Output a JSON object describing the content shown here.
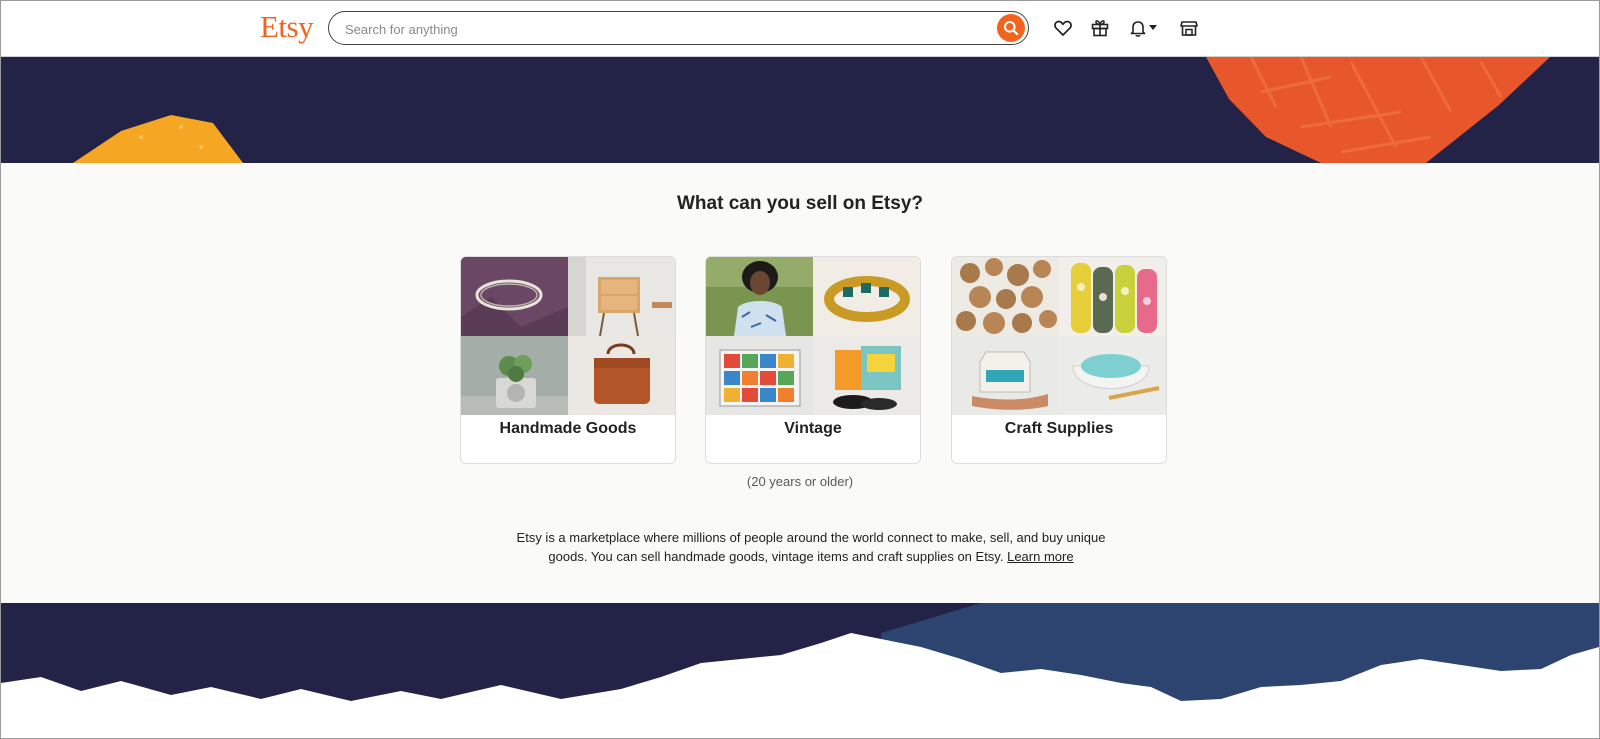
{
  "header": {
    "logo": "Etsy",
    "search": {
      "placeholder": "Search for anything",
      "value": ""
    },
    "icons": [
      "heart-icon",
      "gift-icon",
      "bell-icon",
      "chevron-down-icon",
      "shop-icon"
    ]
  },
  "main": {
    "heading": "What can you sell on Etsy?",
    "cards": [
      {
        "label": "Handmade Goods"
      },
      {
        "label": "Vintage"
      },
      {
        "label": "Craft Supplies"
      }
    ],
    "vintage_note": "(20 years or older)",
    "description": "Etsy is a marketplace where millions of people around the world connect to make, sell, and buy unique goods. You can sell handmade goods, vintage items and craft supplies on Etsy.",
    "learn_more": "Learn more"
  },
  "colors": {
    "brand": "#f1641e",
    "band_dark": "#232347",
    "band_blue": "#2e4470",
    "accent_yellow": "#f5a623"
  }
}
